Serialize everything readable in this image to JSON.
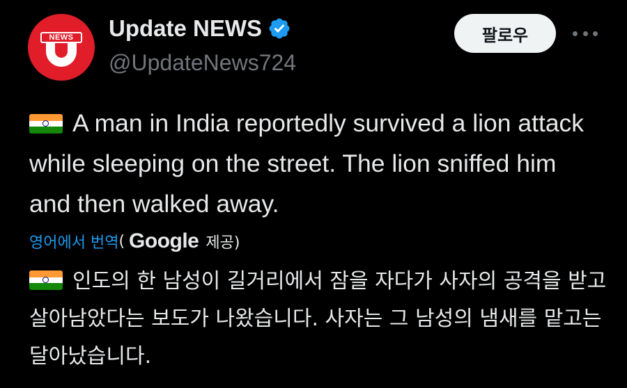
{
  "account": {
    "display_name": "Update NEWS",
    "handle": "@UpdateNews724",
    "avatar_text": "NEWS",
    "verified_icon": "verified-badge-icon"
  },
  "actions": {
    "follow_label": "팔로우",
    "more_icon": "more-options-icon"
  },
  "post": {
    "flag_icon": "india-flag-icon",
    "text": "A man in India reportedly survived a lion attack while sleeping on the street. The lion sniffed him and then walked away."
  },
  "translation": {
    "link_label": "영어에서 번역",
    "open_paren": "(",
    "provider": "Google",
    "provided_label": "제공)",
    "text": "인도의 한 남성이 길거리에서 잠을 자다가 사자의 공격을 받고 살아남았다는 보도가 나왔습니다. 사자는 그 남성의 냄새를 맡고는 달아났습니다."
  },
  "colors": {
    "background": "#000000",
    "text": "#e7e9ea",
    "muted": "#71767b",
    "link": "#1d9bf0",
    "brand_red": "#e11d2a"
  }
}
